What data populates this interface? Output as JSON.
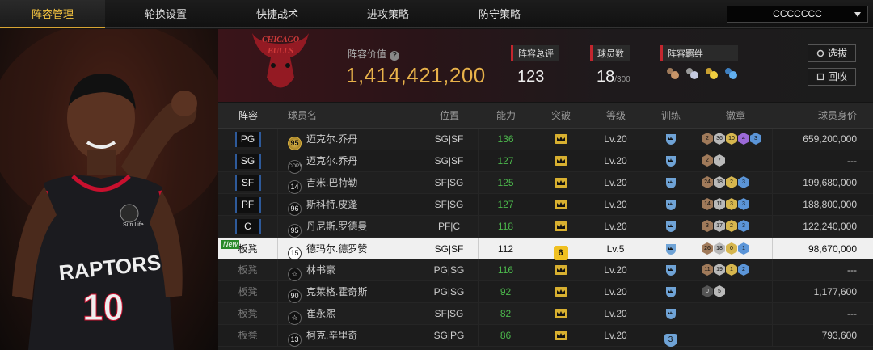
{
  "nav": {
    "tabs": [
      "阵容管理",
      "轮换设置",
      "快捷战术",
      "进攻策略",
      "防守策略"
    ],
    "active_tab": 0,
    "squad_select": "CCCCCCC"
  },
  "header": {
    "team_logo_text": "CHICAGO BULLS",
    "value_label": "阵容价值",
    "value": "1,414,421,200",
    "rating_label": "阵容总评",
    "rating": "123",
    "count_label": "球员数",
    "count": "18",
    "count_max": "/300",
    "chemistry_label": "阵容羁绊",
    "chemistry_icons": [
      "bronze-chem-icon",
      "silver-chem-icon",
      "gold-chem-icon",
      "blue-chem-icon"
    ],
    "btn_select": "选拔",
    "btn_recycle": "回收"
  },
  "table": {
    "columns": [
      "阵容",
      "球员名",
      "位置",
      "能力",
      "突破",
      "等级",
      "训练",
      "徽章",
      "球员身价"
    ],
    "rows": [
      {
        "pos": "PG",
        "bench": false,
        "ovr": "95",
        "ovr_style": "gold",
        "name": "迈克尔.乔丹",
        "positions": "SG|SF",
        "rating": "136",
        "break": "",
        "level": "Lv.20",
        "train": "",
        "badges": [
          [
            "2",
            "bronze"
          ],
          [
            "36",
            "silver"
          ],
          [
            "10",
            "gold"
          ],
          [
            "4",
            "purple"
          ],
          [
            "3",
            "blue"
          ]
        ],
        "salary": "659,200,000"
      },
      {
        "pos": "SG",
        "bench": false,
        "ovr": "COPY",
        "ovr_style": "copy",
        "name": "迈克尔.乔丹",
        "positions": "SG|SF",
        "rating": "127",
        "break": "",
        "level": "Lv.20",
        "train": "",
        "badges": [
          [
            "2",
            "bronze"
          ],
          [
            "7",
            "silver"
          ]
        ],
        "salary": "---"
      },
      {
        "pos": "SF",
        "bench": false,
        "ovr": "14",
        "ovr_style": "",
        "name": "吉米.巴特勒",
        "positions": "SF|SG",
        "rating": "125",
        "break": "",
        "level": "Lv.20",
        "train": "",
        "badges": [
          [
            "24",
            "bronze"
          ],
          [
            "18",
            "silver"
          ],
          [
            "2",
            "gold"
          ],
          [
            "3",
            "blue"
          ]
        ],
        "salary": "199,680,000"
      },
      {
        "pos": "PF",
        "bench": false,
        "ovr": "96",
        "ovr_style": "",
        "name": "斯科特.皮蓬",
        "positions": "SF|SG",
        "rating": "127",
        "break": "",
        "level": "Lv.20",
        "train": "",
        "badges": [
          [
            "14",
            "bronze"
          ],
          [
            "11",
            "silver"
          ],
          [
            "3",
            "gold"
          ],
          [
            "3",
            "blue"
          ]
        ],
        "salary": "188,800,000"
      },
      {
        "pos": "C",
        "bench": false,
        "ovr": "95",
        "ovr_style": "",
        "name": "丹尼斯.罗德曼",
        "positions": "PF|C",
        "rating": "118",
        "break": "",
        "level": "Lv.20",
        "train": "",
        "badges": [
          [
            "3",
            "bronze"
          ],
          [
            "17",
            "silver"
          ],
          [
            "2",
            "gold"
          ],
          [
            "3",
            "blue"
          ]
        ],
        "salary": "122,240,000"
      },
      {
        "pos": "板凳",
        "bench": true,
        "new": "New",
        "selected": true,
        "ovr": "15",
        "ovr_style": "",
        "name": "德玛尔.德罗赞",
        "positions": "SG|SF",
        "rating": "112",
        "break": "6",
        "level": "Lv.5",
        "train": "",
        "badges": [
          [
            "26",
            "bronze"
          ],
          [
            "18",
            "silver"
          ],
          [
            "0",
            "gold"
          ],
          [
            "1",
            "blue"
          ]
        ],
        "salary": "98,670,000"
      },
      {
        "pos": "板凳",
        "bench": true,
        "ovr": "☆",
        "ovr_style": "",
        "name": "林书豪",
        "positions": "PG|SG",
        "rating": "116",
        "break": "",
        "level": "Lv.20",
        "train": "",
        "badges": [
          [
            "11",
            "bronze"
          ],
          [
            "19",
            "silver"
          ],
          [
            "1",
            "gold"
          ],
          [
            "2",
            "blue"
          ]
        ],
        "salary": "---"
      },
      {
        "pos": "板凳",
        "bench": true,
        "ovr": "90",
        "ovr_style": "",
        "name": "克莱格.霍奇斯",
        "positions": "PG|SG",
        "rating": "92",
        "break": "",
        "level": "Lv.20",
        "train": "",
        "badges": [
          [
            "0",
            "dark"
          ],
          [
            "5",
            "silver"
          ]
        ],
        "salary": "1,177,600"
      },
      {
        "pos": "板凳",
        "bench": true,
        "ovr": "☆",
        "ovr_style": "",
        "name": "崔永熙",
        "positions": "SF|SG",
        "rating": "82",
        "break": "",
        "level": "Lv.20",
        "train": "",
        "badges": [],
        "salary": "---"
      },
      {
        "pos": "板凳",
        "bench": true,
        "ovr": "13",
        "ovr_style": "",
        "name": "柯克.辛里奇",
        "positions": "SG|PG",
        "rating": "86",
        "break": "",
        "level": "Lv.20",
        "train": "3",
        "badges": [],
        "salary": "793,600"
      }
    ]
  },
  "colors": {
    "accent_gold": "#e8b24a",
    "rating_green": "#4cb84c",
    "bulls_red": "#c3262e"
  },
  "player_art": {
    "jersey_text": "RAPTORS",
    "jersey_number": "10",
    "patch": "Sun Life"
  }
}
